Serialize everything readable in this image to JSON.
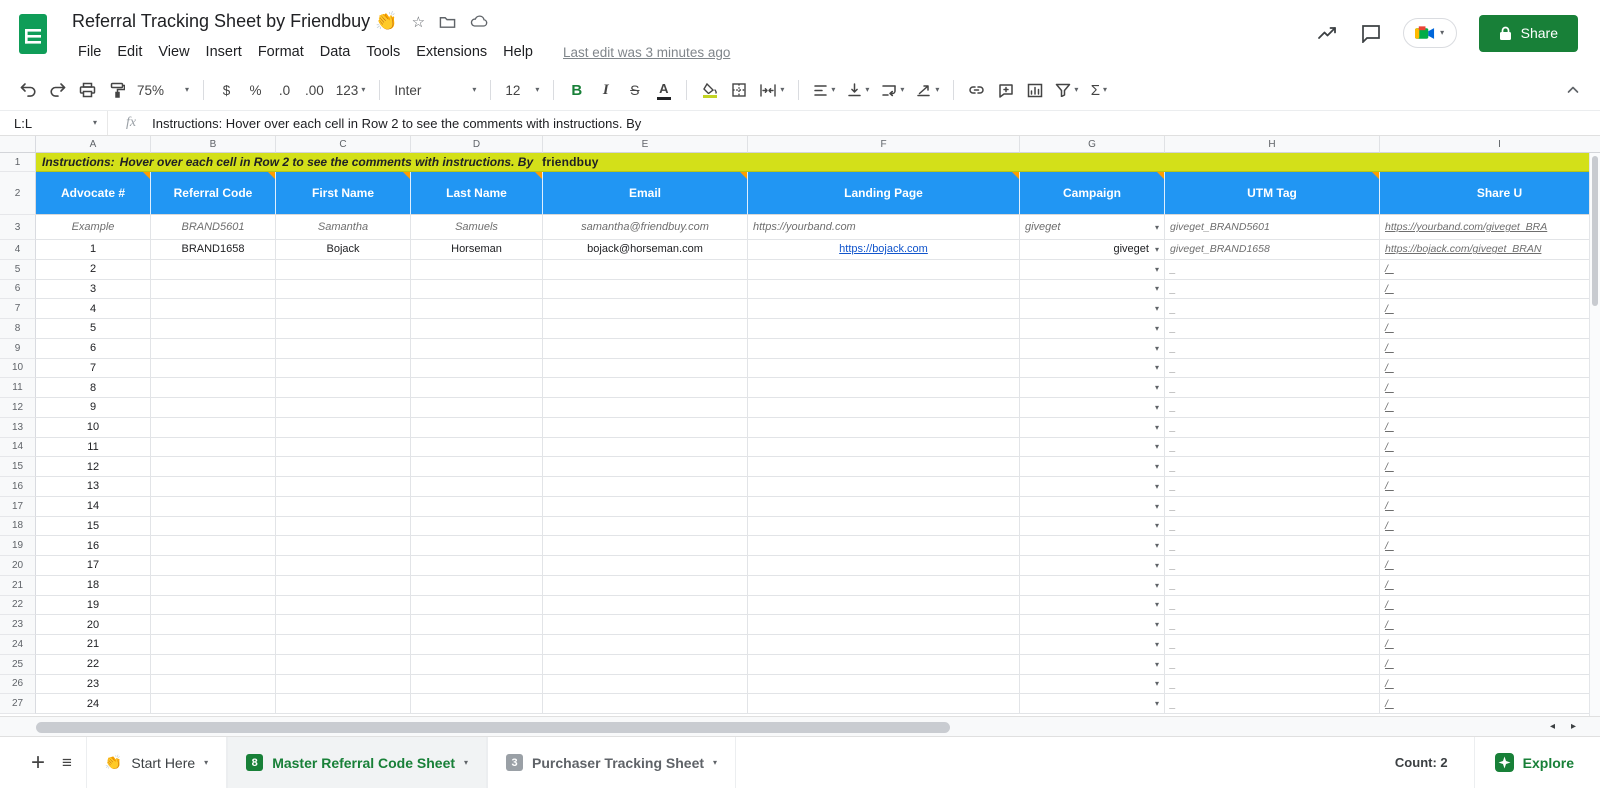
{
  "colors": {
    "header_blue": "#2196f3",
    "instructions_lime": "#d3e019",
    "accent_green": "#188038",
    "sheets_logo_green": "#0f9d58",
    "link_blue": "#1155cc",
    "comment_orange": "#ff9d00"
  },
  "titlebar": {
    "doc_title": "Referral Tracking Sheet by Friendbuy 👏",
    "menus": [
      "File",
      "Edit",
      "View",
      "Insert",
      "Format",
      "Data",
      "Tools",
      "Extensions",
      "Help"
    ],
    "last_edit": "Last edit was 3 minutes ago",
    "share_label": "Share"
  },
  "toolbar": {
    "zoom": "75%",
    "currency": "$",
    "percent": "%",
    "decimal_decrease": ".0",
    "decimal_increase": ".00",
    "more_formats": "123",
    "font_name": "Inter",
    "font_size": "12",
    "bold": "B",
    "italic": "I",
    "strikethrough": "S",
    "text_color": "A",
    "functions": "Σ"
  },
  "formula_bar": {
    "name_box": "L:L",
    "fx_label": "fx",
    "content": "Instructions: Hover over each cell in Row 2 to see the comments with instructions. By"
  },
  "grid": {
    "column_letters": [
      "A",
      "B",
      "C",
      "D",
      "E",
      "F",
      "G",
      "H",
      "I"
    ],
    "row_numbers": [
      "1",
      "2",
      "3",
      "4",
      "5",
      "6",
      "7",
      "8",
      "9",
      "10",
      "11",
      "12",
      "13",
      "14",
      "15",
      "16",
      "17",
      "18",
      "19",
      "20",
      "21",
      "22",
      "23",
      "24",
      "25",
      "26",
      "27"
    ],
    "instructions": {
      "bold_label": "Instructions:",
      "italic_text": "Hover over each cell in Row 2 to see the comments with instructions. By",
      "brand": "friendbuy"
    },
    "headers": [
      "Advocate #",
      "Referral Code",
      "First Name",
      "Last Name",
      "Email",
      "Landing Page",
      "Campaign",
      "UTM Tag",
      "Share U"
    ],
    "example_row": {
      "advocate": "Example",
      "referral_code": "BRAND5601",
      "first_name": "Samantha",
      "last_name": "Samuels",
      "email": "samantha@friendbuy.com",
      "landing_page": "https://yourband.com",
      "campaign": "giveget",
      "utm_tag": "giveget_BRAND5601",
      "share_url": "https://yourband.com/giveget_BRA"
    },
    "entry_row": {
      "advocate": "1",
      "referral_code": "BRAND1658",
      "first_name": "Bojack",
      "last_name": "Horseman",
      "email": "bojack@horseman.com",
      "landing_page": "https://bojack.com",
      "campaign": "giveget",
      "utm_tag": "giveget_BRAND1658",
      "share_url": "https://bojack.com/giveget_BRAN"
    },
    "empty_rows": {
      "advocate_numbers": [
        "2",
        "3",
        "4",
        "5",
        "6",
        "7",
        "8",
        "9",
        "10",
        "11",
        "12",
        "13",
        "14",
        "15",
        "16",
        "17",
        "18",
        "19",
        "20",
        "21",
        "22",
        "23",
        "24"
      ],
      "utm_value": "_",
      "share_value": "/_"
    }
  },
  "scrollbar": {
    "left_arrow": "◂",
    "right_arrow": "▸"
  },
  "tabs": {
    "add_label": "+",
    "items": [
      {
        "icon": "👏",
        "label": "Start Here"
      },
      {
        "badge": "8",
        "label": "Master Referral Code Sheet"
      },
      {
        "badge": "3",
        "label": "Purchaser Tracking Sheet"
      }
    ],
    "count_label": "Count: 2",
    "explore_label": "Explore"
  }
}
